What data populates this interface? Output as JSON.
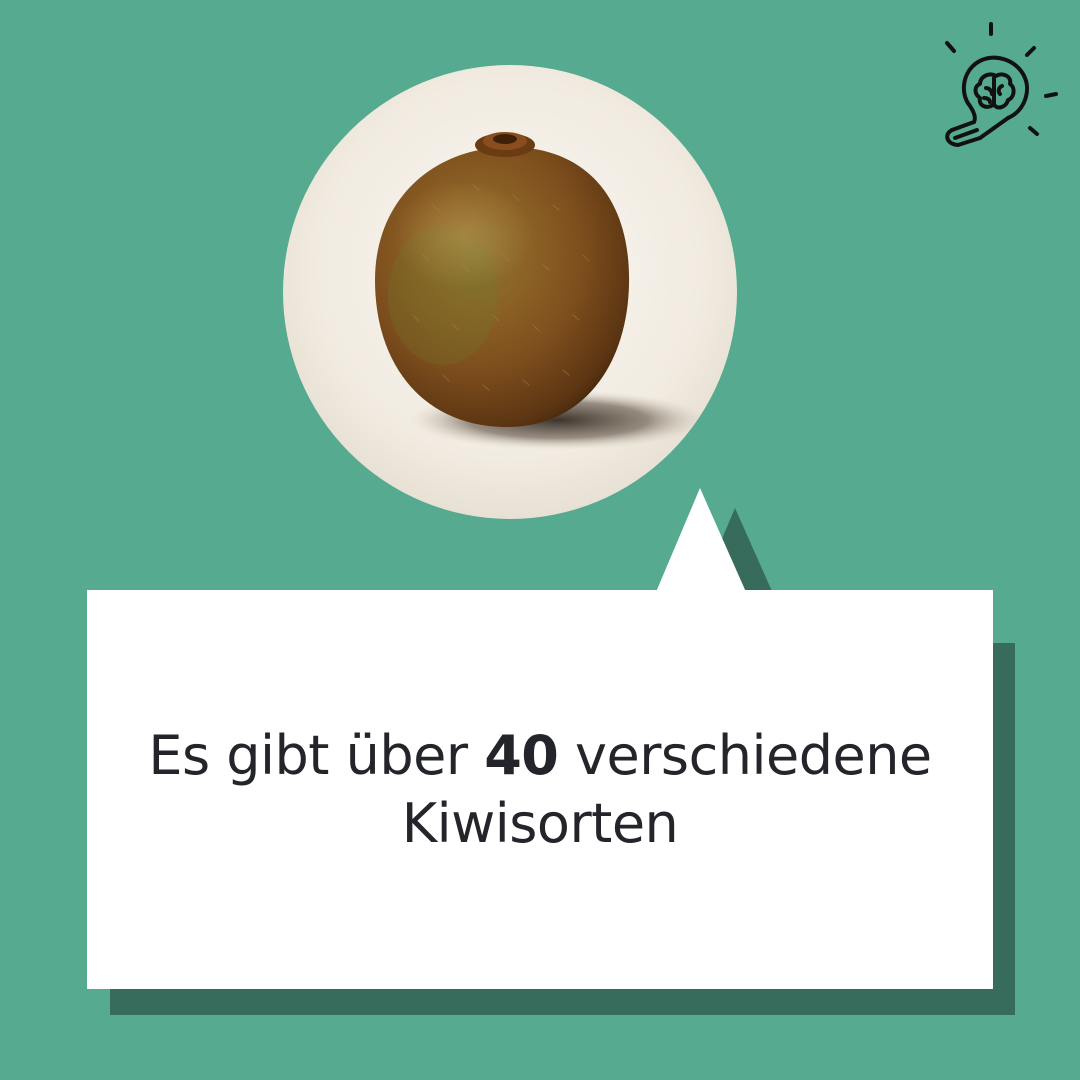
{
  "fact": {
    "before": "Es gibt über ",
    "highlight": "40",
    "after": " verschiedene",
    "line2": "Kiwisorten"
  },
  "icons": {
    "corner": "lightbulb-brain-icon"
  },
  "colors": {
    "background": "#55aa8f",
    "shadow": "#376b5b",
    "card": "#ffffff",
    "text": "#23252b"
  }
}
